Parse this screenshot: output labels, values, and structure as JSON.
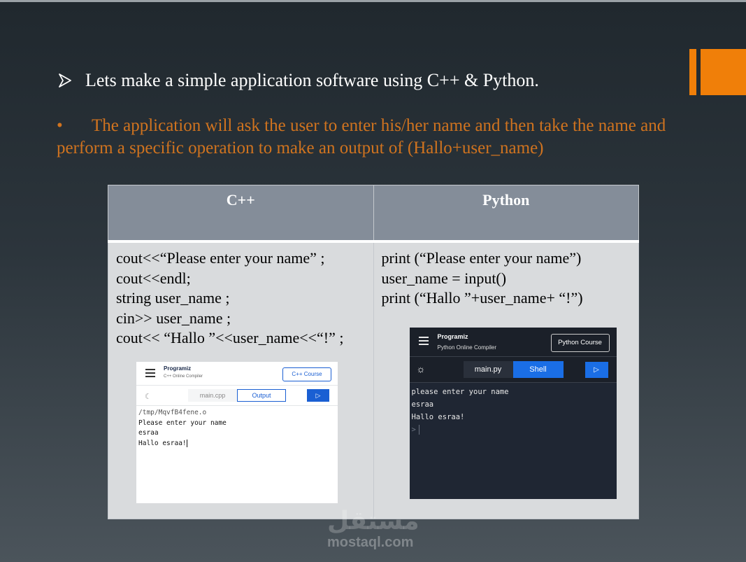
{
  "slide": {
    "bullet1": "Lets make a simple application software using C++ & Python.",
    "bullet2_marker": "•",
    "bullet2": "The application will ask the user to enter his/her  name and then take the name and perform  a specific operation to make an output of  (Hallo+user_name)"
  },
  "table": {
    "headers": [
      "C++",
      "Python"
    ],
    "cpp_code": [
      "cout<<“Please enter your name” ;",
      "cout<<endl;",
      "string user_name ;",
      "cin>> user_name ;",
      "cout<< “Hallo ”<<user_name<<“!” ;"
    ],
    "python_code": [
      "print (“Please enter your name”)",
      "user_name = input()",
      "print (“Hallo ”+user_name+ “!”)"
    ]
  },
  "cpp_screenshot": {
    "logo": "Programiz",
    "subtitle": "C++ Online Compiler",
    "course_button": "C++ Course",
    "file_tab": "main.cpp",
    "output_tab": "Output",
    "run_icon": "play-icon",
    "terminal": [
      "/tmp/MqvfB4fene.o",
      "Please enter your name",
      "esraa",
      "Hallo esraa!"
    ]
  },
  "python_screenshot": {
    "logo": "Programiz",
    "subtitle": "Python Online Compiler",
    "course_button": "Python Course",
    "file_tab": "main.py",
    "shell_tab": "Shell",
    "run_icon": "play-icon",
    "terminal": [
      "please enter your name",
      "esraa",
      "Hallo esraa!"
    ],
    "prompt": ">"
  },
  "watermark": {
    "arabic": "مستقل",
    "latin": "mostaql.com"
  },
  "colors": {
    "accent": "#f07f09",
    "bullet2_text": "#d0731f",
    "table_header": "#848d99",
    "table_body": "#d9dbdd"
  }
}
